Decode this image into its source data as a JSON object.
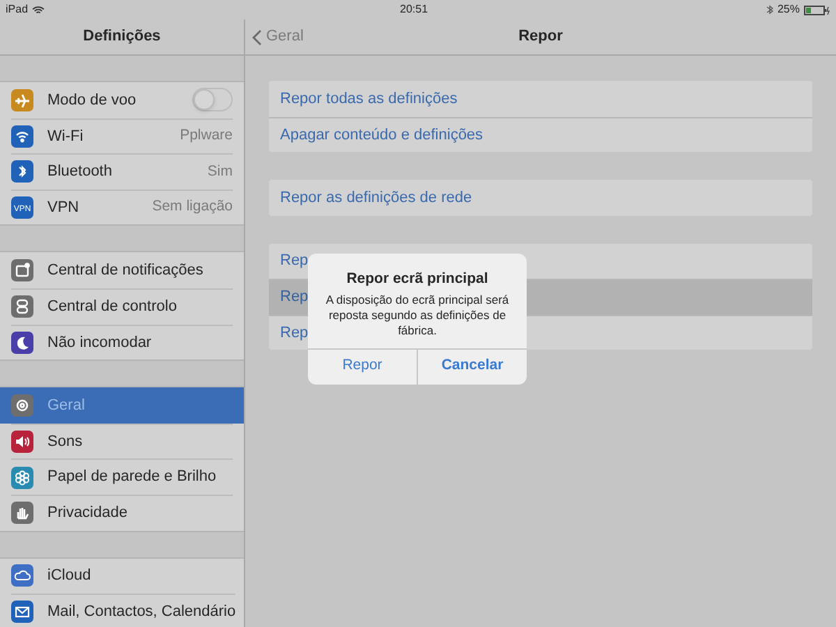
{
  "status_bar": {
    "device": "iPad",
    "time": "20:51",
    "battery": "25%"
  },
  "sidebar": {
    "title": "Definições",
    "groups": [
      [
        {
          "label": "Modo de voo",
          "color": "#c88a1e",
          "kind": "toggle",
          "on": false,
          "selected": false
        },
        {
          "label": "Wi-Fi",
          "color": "#1f62b8",
          "kind": "value",
          "value": "Pplware",
          "selected": false
        },
        {
          "label": "Bluetooth",
          "color": "#1f62b8",
          "kind": "value",
          "value": "Sim",
          "selected": false
        },
        {
          "label": "VPN",
          "color": "#1f62b8",
          "kind": "value",
          "value": "Sem ligação",
          "selected": false,
          "badge": "VPN"
        }
      ],
      [
        {
          "label": "Central de notificações",
          "color": "#6e6e6e",
          "kind": "plain",
          "selected": false
        },
        {
          "label": "Central de controlo",
          "color": "#6e6e6e",
          "kind": "plain",
          "selected": false
        },
        {
          "label": "Não incomodar",
          "color": "#4a3fa8",
          "kind": "plain",
          "selected": false
        }
      ],
      [
        {
          "label": "Geral",
          "color": "#6e6e6e",
          "kind": "plain",
          "selected": true
        },
        {
          "label": "Sons",
          "color": "#b8223a",
          "kind": "plain",
          "selected": false
        },
        {
          "label": "Papel de parede e Brilho",
          "color": "#2a8bb0",
          "kind": "plain",
          "selected": false
        },
        {
          "label": "Privacidade",
          "color": "#6e6e6e",
          "kind": "plain",
          "selected": false
        }
      ],
      [
        {
          "label": "iCloud",
          "color": "#3e6fc4",
          "kind": "plain",
          "selected": false
        },
        {
          "label": "Mail, Contactos, Calendário",
          "color": "#1f62b8",
          "kind": "plain",
          "selected": false
        }
      ]
    ]
  },
  "nav": {
    "back": "Geral",
    "title": "Repor"
  },
  "groups": [
    [
      {
        "label": "Repor todas as definições",
        "selected": false
      },
      {
        "label": "Apagar conteúdo e definições",
        "selected": false
      }
    ],
    [
      {
        "label": "Repor as definições de rede",
        "selected": false
      }
    ],
    [
      {
        "label": "Rep",
        "selected": false
      },
      {
        "label": "Rep",
        "selected": true
      },
      {
        "label": "Rep",
        "selected": false
      }
    ]
  ],
  "alert": {
    "title": "Repor ecrã principal",
    "message": "A disposição do ecrã principal será reposta segundo as definições de fábrica.",
    "buttons": [
      {
        "label": "Repor",
        "bold": false
      },
      {
        "label": "Cancelar",
        "bold": true
      }
    ]
  }
}
